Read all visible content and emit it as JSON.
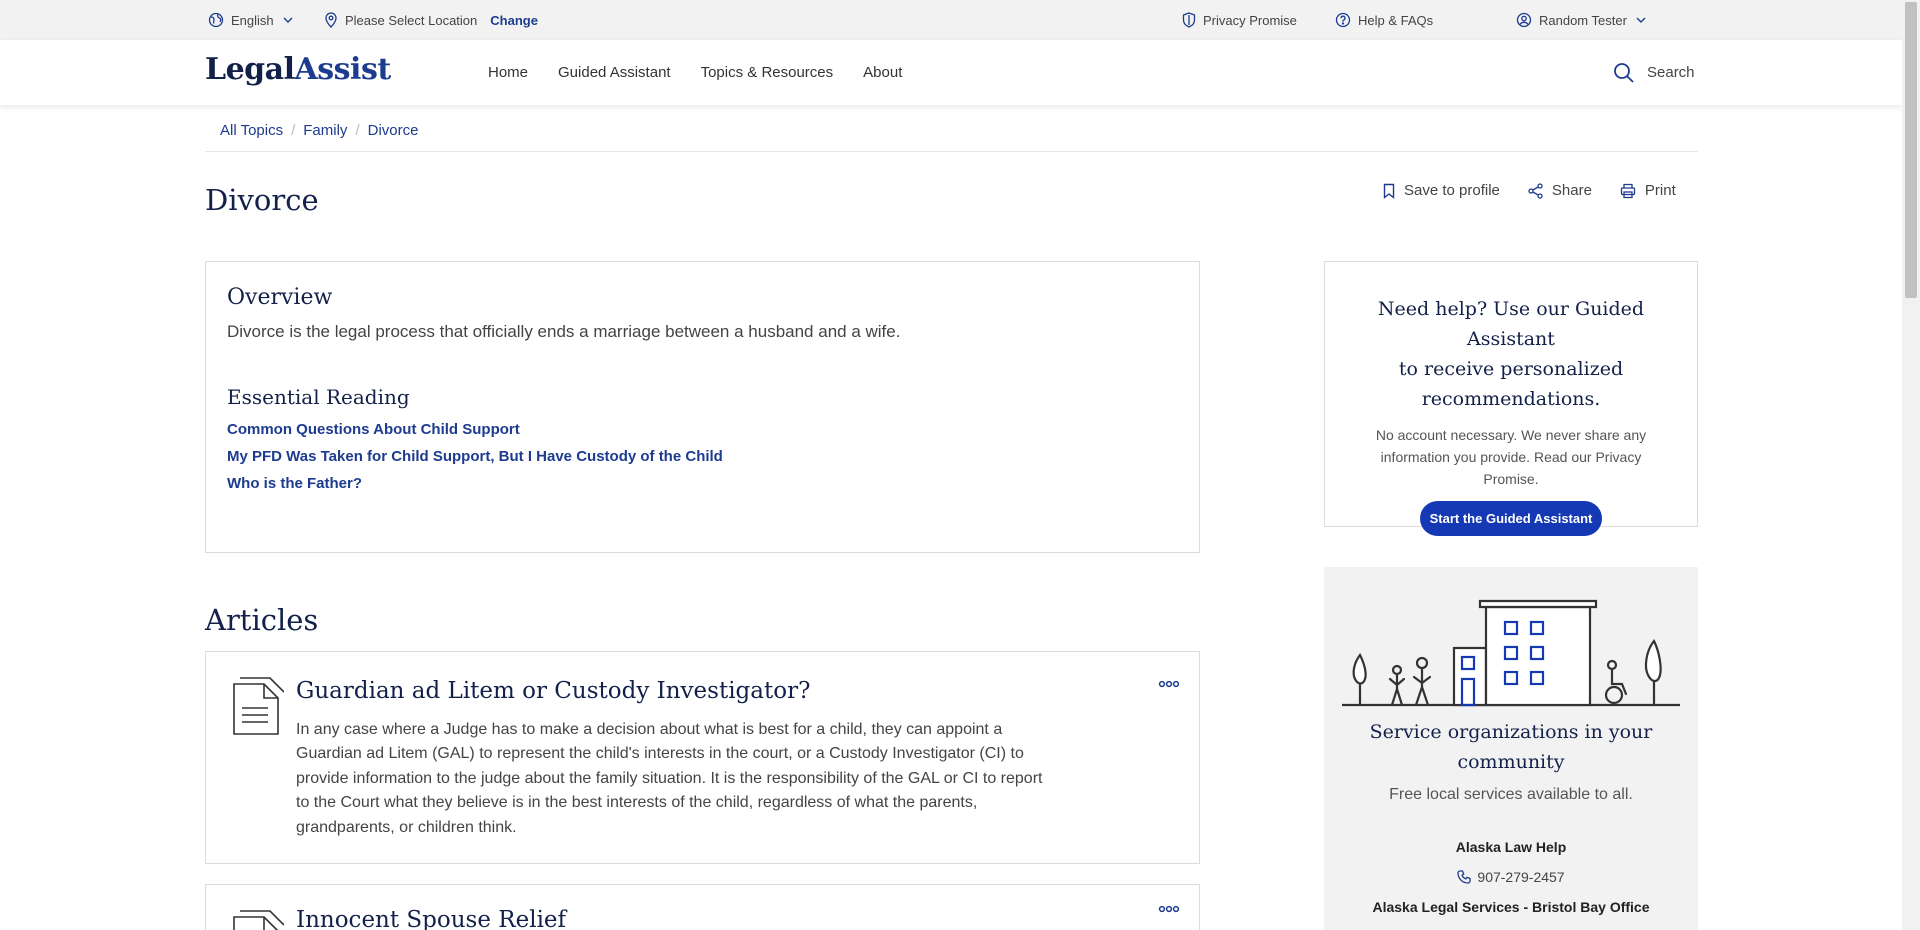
{
  "utility_bar": {
    "language": "English",
    "location_prompt": "Please Select Location",
    "change_label": "Change",
    "privacy": "Privacy Promise",
    "help": "Help & FAQs",
    "user": "Random Tester"
  },
  "header": {
    "logo_part1": "Legal",
    "logo_part2": "Assist",
    "nav": [
      "Home",
      "Guided Assistant",
      "Topics & Resources",
      "About"
    ],
    "search_label": "Search"
  },
  "breadcrumb": [
    "All Topics",
    "Family",
    "Divorce"
  ],
  "page": {
    "title": "Divorce",
    "actions": {
      "save": "Save to profile",
      "share": "Share",
      "print": "Print"
    }
  },
  "overview": {
    "title": "Overview",
    "text": "Divorce is the legal process that officially ends a marriage between a husband and a wife.",
    "essential_title": "Essential Reading",
    "links": [
      "Common Questions About Child Support",
      "My PFD Was Taken for Child Support, But I Have Custody of the Child",
      "Who is the Father?"
    ]
  },
  "articles": {
    "title": "Articles",
    "items": [
      {
        "title": "Guardian ad Litem or Custody Investigator?",
        "lines": [
          "In any case where a Judge has to make a decision about what is best for a child, they can appoint a",
          "Guardian ad Litem (GAL) to represent the child's interests in the court, or a Custody Investigator (CI) to",
          "provide information to the judge about the family situation. It is the responsibility of the GAL or CI to report",
          "to the Court what they believe is in the best interests of the child, regardless of what the parents,",
          "grandparents, or children think."
        ]
      },
      {
        "title": "Innocent Spouse Relief",
        "lines": []
      }
    ]
  },
  "help_card": {
    "title_lines": [
      "Need help? Use our Guided Assistant",
      "to receive personalized",
      "recommendations."
    ],
    "text_lines": [
      "No account necessary. We never share any",
      "information you provide. Read our Privacy",
      "Promise."
    ],
    "button": "Start the Guided Assistant"
  },
  "service_card": {
    "title_lines": [
      "Service organizations in your",
      "community"
    ],
    "subtitle": "Free local services available to all.",
    "org1": "Alaska Law Help",
    "phone1": "907-279-2457",
    "org2": "Alaska Legal Services - Bristol Bay Office"
  },
  "colors": {
    "brand_navy": "#13214a",
    "link_blue": "#1d3c8f",
    "button_blue": "#1538b4"
  }
}
